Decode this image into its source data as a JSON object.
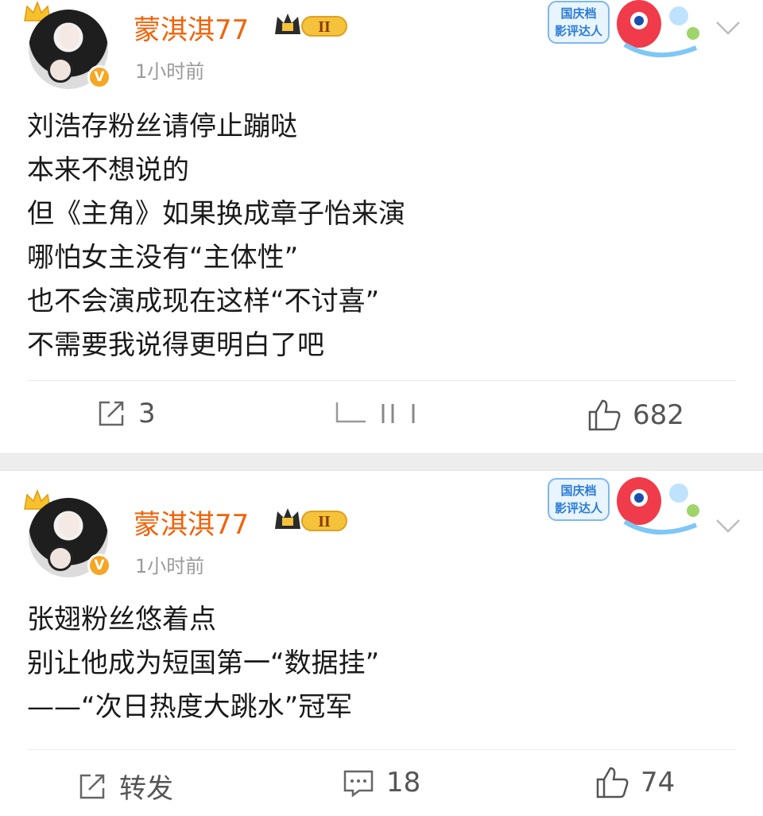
{
  "posts": [
    {
      "username": "蒙淇淇77",
      "level": "II",
      "timestamp": "1小时前",
      "badge_text": [
        "国庆档",
        "影评达人"
      ],
      "content": [
        "刘浩存粉丝请停止蹦哒",
        "本来不想说的",
        "但《主角》如果换成章子怡来演",
        "哪怕女主没有“主体性”",
        "也不会演成现在这样“不讨喜”",
        "不需要我说得更明白了吧"
      ],
      "actions": {
        "repost": "3",
        "comment": "",
        "like": "682"
      }
    },
    {
      "username": "蒙淇淇77",
      "level": "II",
      "timestamp": "1小时前",
      "badge_text": [
        "国庆档",
        "影评达人"
      ],
      "content": [
        "张翅粉丝悠着点",
        "别让他成为短国第一“数据挂”",
        "——“次日热度大跳水”冠军"
      ],
      "actions": {
        "repost": "转发",
        "comment": "18",
        "like": "74"
      }
    }
  ],
  "colors": {
    "username": "#f0630a",
    "meta": "#9a9a9a",
    "separator": "#ededed",
    "verified": "#f5a623"
  }
}
